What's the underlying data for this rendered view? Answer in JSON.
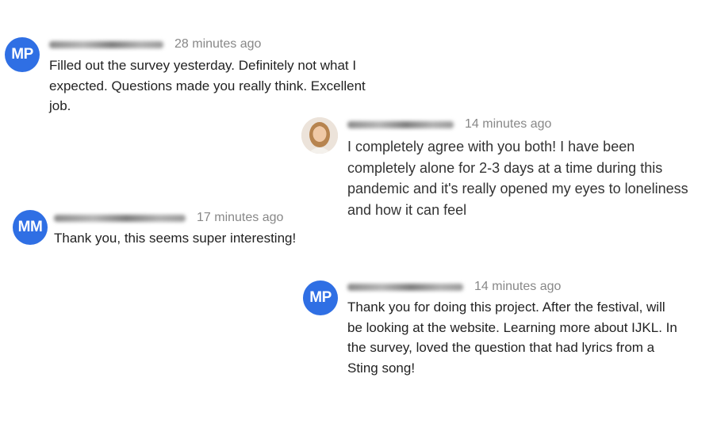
{
  "comments": [
    {
      "avatar_initials": "MP",
      "timestamp": "28 minutes ago",
      "text": "Filled out the survey yesterday. Definitely not what I expected. Questions made you really think. Excellent job."
    },
    {
      "avatar_initials": "",
      "timestamp": "14 minutes ago",
      "text": "I completely agree with you both! I have been completely alone for 2-3 days at a time during this pandemic and it's really opened my eyes to loneliness and how it can feel"
    },
    {
      "avatar_initials": "MM",
      "timestamp": "17 minutes ago",
      "text": "Thank you, this seems super interesting!"
    },
    {
      "avatar_initials": "MP",
      "timestamp": "14 minutes ago",
      "text": "Thank you for doing this project. After the festival, will be looking at the website. Learning more about IJKL. In the survey, loved the question that had lyrics from a Sting song!"
    }
  ],
  "colors": {
    "avatar": "#2f6fe4",
    "timestamp": "#888888",
    "text": "#222222"
  },
  "icons": {
    "photo_avatar": "user-photo-avatar"
  }
}
